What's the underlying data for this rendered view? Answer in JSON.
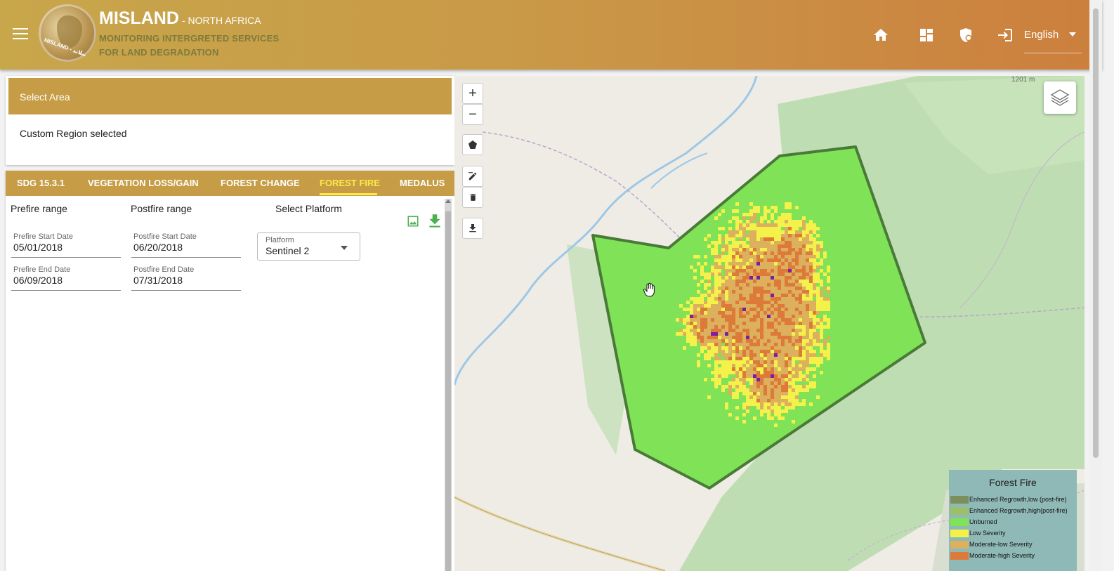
{
  "header": {
    "title": "MISLAND",
    "subtitle": "- NORTH AFRICA",
    "tagline_line1": "MONITORING INTERGRETED SERVICES",
    "tagline_line2": "FOR LAND DEGRADATION",
    "logo_text": "MISLAND - مسلاند",
    "icons": [
      "menu-icon",
      "home-icon",
      "dashboard-icon",
      "security-icon",
      "login-icon"
    ],
    "language": "English"
  },
  "select_area": {
    "title": "Select Area",
    "status": "Custom Region selected"
  },
  "tabs": [
    {
      "label": "SDG 15.3.1",
      "active": false
    },
    {
      "label": "VEGETATION LOSS/GAIN",
      "active": false
    },
    {
      "label": "FOREST CHANGE",
      "active": false
    },
    {
      "label": "FOREST FIRE",
      "active": true
    },
    {
      "label": "MEDALUS",
      "active": false
    }
  ],
  "forest_fire": {
    "prefire_label": "Prefire range",
    "postfire_label": "Postfire range",
    "platform_label": "Select Platform",
    "prefire_start": {
      "label": "Prefire Start Date",
      "value": "05/01/2018"
    },
    "prefire_end": {
      "label": "Prefire End Date",
      "value": "06/09/2018"
    },
    "postfire_start": {
      "label": "Postfire Start Date",
      "value": "06/20/2018"
    },
    "postfire_end": {
      "label": "Postfire End Date",
      "value": "07/31/2018"
    },
    "platform": {
      "label": "Platform",
      "value": "Sentinel 2"
    }
  },
  "map": {
    "elevation_label": "1201 m",
    "controls": [
      "zoom-in",
      "zoom-out",
      "draw-polygon",
      "edit",
      "delete",
      "download"
    ],
    "legend": {
      "title": "Forest Fire",
      "items": [
        {
          "label": "Enhanced Regrowth,low (post-fire)",
          "color": "#7a8f5a"
        },
        {
          "label": "Enhanced Regrowth,high(post-fire)",
          "color": "#9cbf6a"
        },
        {
          "label": "Unburned",
          "color": "#7fe257"
        },
        {
          "label": "Low Severity",
          "color": "#f4f24a"
        },
        {
          "label": "Moderate-low Severity",
          "color": "#dcb05c"
        },
        {
          "label": "Moderate-high Severity",
          "color": "#dd7a3a"
        }
      ]
    }
  },
  "colors": {
    "header_start": "#c8a64a",
    "header_end": "#cc7f3e",
    "panel_gold": "#c69d46",
    "active_tab": "#fbe94a",
    "unburned": "#7fe257",
    "low_severity": "#f4f24a",
    "moderate_low": "#dcb05c",
    "moderate_high": "#dd7a3a",
    "high_severity": "#7a1fa2"
  }
}
